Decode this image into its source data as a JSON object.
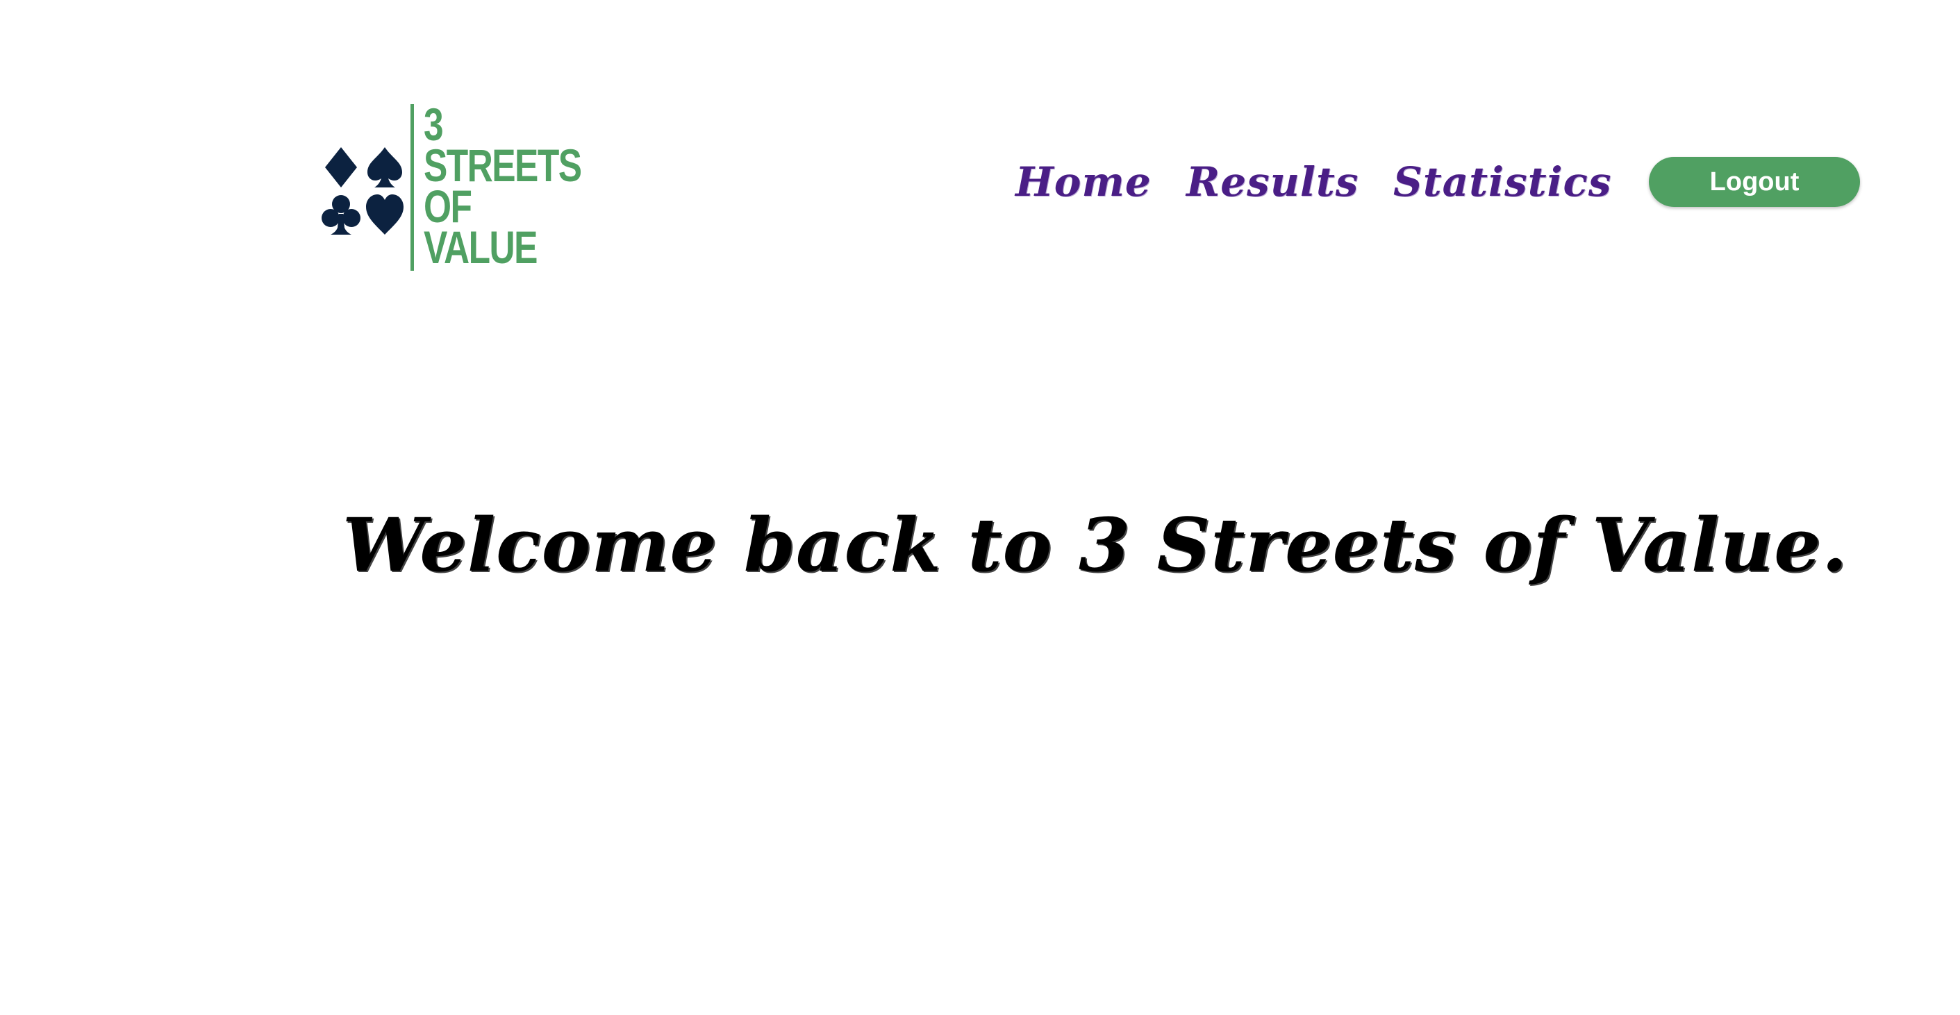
{
  "brand": {
    "logo_lines": [
      "3",
      "STREETS",
      "OF",
      "VALUE"
    ],
    "suit_icons": [
      "diamond-icon",
      "spade-icon",
      "club-icon",
      "heart-icon"
    ],
    "suit_color": "#0c2240",
    "text_color": "#50a062"
  },
  "nav": {
    "items": [
      {
        "label": "Home"
      },
      {
        "label": "Results"
      },
      {
        "label": "Statistics"
      }
    ],
    "link_color": "#4a1e86"
  },
  "auth": {
    "logout_label": "Logout",
    "button_color": "#50a062"
  },
  "main": {
    "welcome_text": "Welcome back to 3 Streets of Value."
  }
}
